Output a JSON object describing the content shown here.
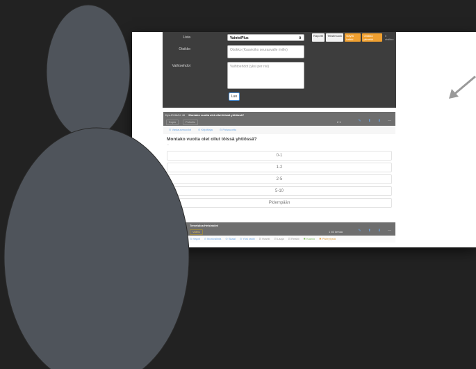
{
  "form": {
    "list_label": "Lista",
    "list_value": "VainteiPlus",
    "title_label": "Otsikko",
    "title_placeholder": "Otsikko (Kaavioiko seuraavalle riville)",
    "options_label": "Vaihtoehdot",
    "options_placeholder": "Vaihtoehdot (yksi per rivi)",
    "save_label": "Luo"
  },
  "tags": [
    {
      "label": "Raportti",
      "style": "white"
    },
    {
      "label": "Tekstimuoto",
      "style": "white"
    },
    {
      "label": "Näytä kaikki",
      "style": "orange"
    },
    {
      "label": "Otsikko piirrettä",
      "style": "orange"
    },
    {
      "label": "0 otsikko",
      "style": "plain"
    }
  ],
  "card1": {
    "id_label": "Kys-ID:ltä/id: 46",
    "title": "Montako vuotta olet ollut töissä yhtiössä?",
    "btn1": "Kopio",
    "btn2": "Puhuttu",
    "stat": "2  1"
  },
  "toolbar_links": [
    "Vastausmuodot",
    "Kirjoittaja",
    "Poissuoritu"
  ],
  "question_text": "Montako vuotta olet ollut töissä yhtiössä?",
  "options": [
    "0-1",
    "1-2",
    "2-5",
    "5-10",
    "Pidempään"
  ],
  "card2": {
    "title": "Tervetuloa Helsinkiin!",
    "sub": "Kys-ID:ltä/id: 47",
    "badge": "Valittu",
    "stat": "1  46 kertaa"
  },
  "tools": [
    {
      "label": "Hajoti",
      "style": "blue"
    },
    {
      "label": "Monivalinta",
      "style": "blue"
    },
    {
      "label": "Skaal",
      "style": "blue"
    },
    {
      "label": "Yksi rastit",
      "style": "blue"
    },
    {
      "label": "Hashti",
      "style": "grey"
    },
    {
      "label": "Laaja",
      "style": "grey"
    },
    {
      "label": "Reakti",
      "style": "grey"
    },
    {
      "label": "Kaavio",
      "style": "green"
    },
    {
      "label": "Pisteytystä",
      "style": "orange"
    }
  ],
  "colors": {
    "background": "#222222",
    "panel": "#3d3d3d",
    "card_header": "#6e6e6e",
    "accent_orange": "#f0a030",
    "link_blue": "#6aa6e6",
    "silhouette": "#4f545b"
  }
}
